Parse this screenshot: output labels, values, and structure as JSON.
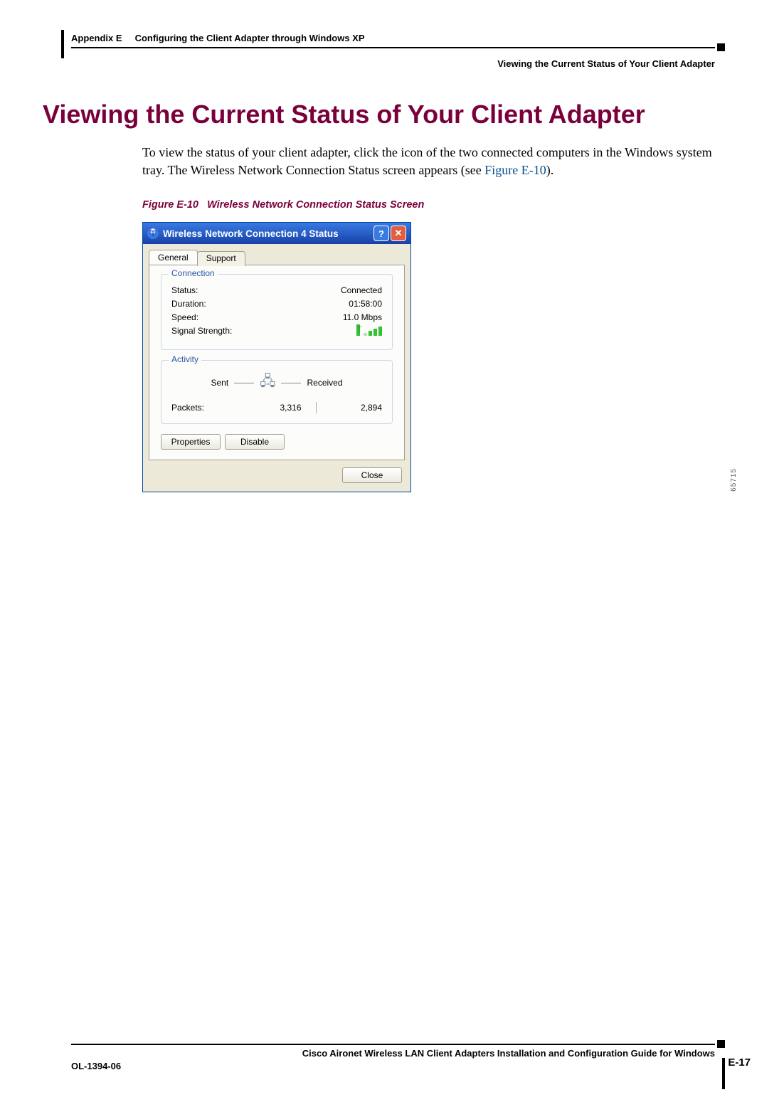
{
  "header": {
    "left_prefix": "Appendix E",
    "left_title": "Configuring the Client Adapter through Windows XP",
    "right_title": "Viewing the Current Status of Your Client Adapter"
  },
  "heading": "Viewing the Current Status of Your Client Adapter",
  "paragraph": {
    "text_before": "To view the status of your client adapter, click the icon of the two connected computers in the Windows system tray. The Wireless Network Connection Status screen appears (see ",
    "link_text": "Figure E-10",
    "text_after": ")."
  },
  "figure_caption": {
    "label": "Figure E-10",
    "title": "Wireless Network Connection Status Screen"
  },
  "dialog": {
    "title": "Wireless Network Connection 4 Status",
    "tabs": {
      "general": "General",
      "support": "Support"
    },
    "connection": {
      "legend": "Connection",
      "status_label": "Status:",
      "status_value": "Connected",
      "duration_label": "Duration:",
      "duration_value": "01:58:00",
      "speed_label": "Speed:",
      "speed_value": "11.0 Mbps",
      "signal_label": "Signal Strength:"
    },
    "activity": {
      "legend": "Activity",
      "sent_label": "Sent",
      "received_label": "Received",
      "packets_label": "Packets:",
      "sent_value": "3,316",
      "received_value": "2,894"
    },
    "buttons": {
      "properties": "Properties",
      "disable": "Disable",
      "close": "Close"
    },
    "side_number": "65715"
  },
  "footer": {
    "guide_title": "Cisco Aironet Wireless LAN Client Adapters Installation and Configuration Guide for Windows",
    "doc_number": "OL-1394-06",
    "page_number": "E-17"
  }
}
